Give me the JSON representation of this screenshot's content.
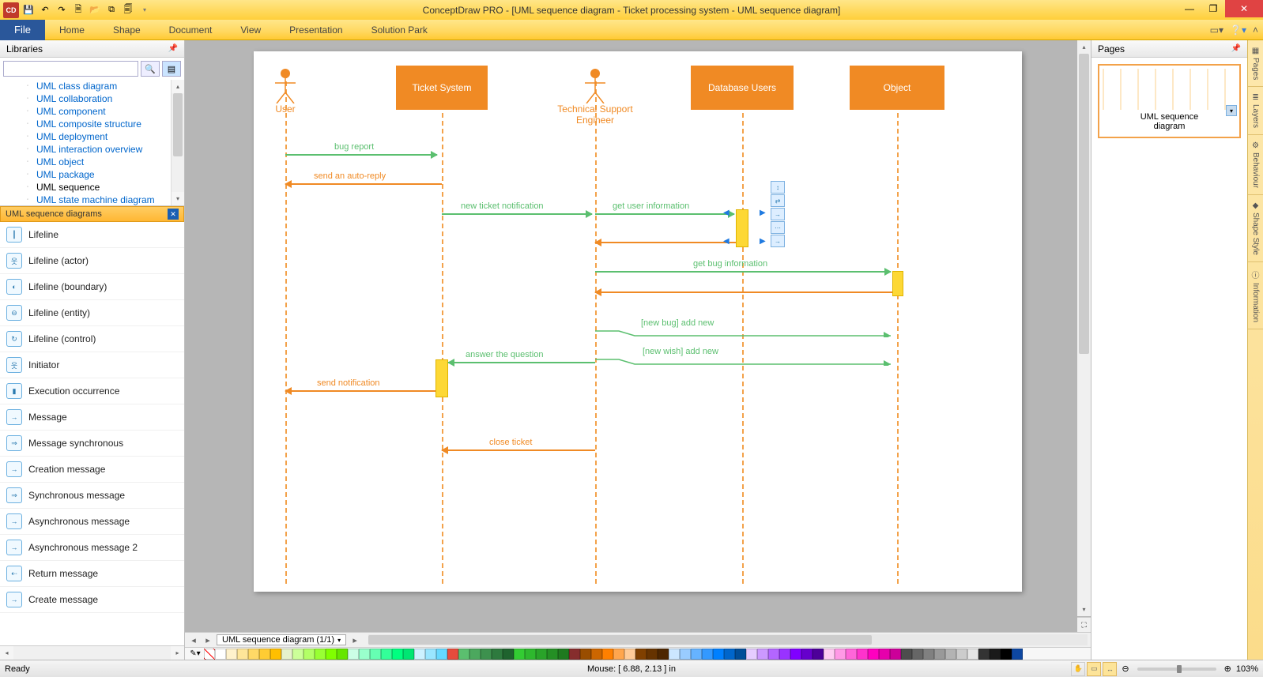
{
  "titlebar": {
    "title": "ConceptDraw PRO - [UML sequence diagram - Ticket processing system - UML sequence diagram]"
  },
  "ribbon": {
    "file": "File",
    "tabs": [
      "Home",
      "Shape",
      "Document",
      "View",
      "Presentation",
      "Solution Park"
    ]
  },
  "libraries": {
    "title": "Libraries",
    "search_placeholder": "",
    "tree": [
      "UML class diagram",
      "UML collaboration",
      "UML component",
      "UML composite structure",
      "UML deployment",
      "UML interaction overview",
      "UML object",
      "UML package",
      "UML sequence",
      "UML state machine diagram"
    ],
    "tree_selected_index": 8,
    "stencil_title": "UML sequence diagrams",
    "shapes": [
      "Lifeline",
      "Lifeline (actor)",
      "Lifeline (boundary)",
      "Lifeline (entity)",
      "Lifeline (control)",
      "Initiator",
      "Execution occurrence",
      "Message",
      "Message synchronous",
      "Creation message",
      "Synchronous message",
      "Asynchronous message",
      "Asynchronous message 2",
      "Return message",
      "Create message"
    ]
  },
  "diagram": {
    "actors": {
      "user": "User",
      "engineer_l1": "Technical Support",
      "engineer_l2": "Engineer"
    },
    "participants": {
      "ticket": "Ticket System",
      "db": "Database Users",
      "obj": "Object"
    },
    "messages": {
      "bug_report": "bug report",
      "auto_reply": "send an auto-reply",
      "new_ticket": "new ticket notification",
      "get_user": "get user information",
      "get_bug": "get bug information",
      "add_bug": "[new bug] add new",
      "add_wish": "[new wish] add new",
      "answer": "answer the question",
      "send_notif": "send notification",
      "close": "close ticket"
    }
  },
  "page_tabs": {
    "name": "UML sequence diagram (1/1)"
  },
  "pages_panel": {
    "title": "Pages",
    "thumb_caption_l1": "UML sequence",
    "thumb_caption_l2": "diagram"
  },
  "side_tabs": [
    "Pages",
    "Layers",
    "Behaviour",
    "Shape Style",
    "Information"
  ],
  "statusbar": {
    "ready": "Ready",
    "mouse": "Mouse: [ 6.88, 2.13 ] in",
    "zoom": "103%"
  },
  "colors": [
    "#ffffff",
    "#fff2cc",
    "#ffe699",
    "#ffd966",
    "#ffcc33",
    "#ffbf00",
    "#e6f2cc",
    "#ccff99",
    "#b3ff66",
    "#99ff33",
    "#80ff00",
    "#66e600",
    "#ccffe6",
    "#99ffcc",
    "#66ffb3",
    "#33ff99",
    "#00ff80",
    "#00e673",
    "#ccf2ff",
    "#99e6ff",
    "#66d9ff",
    "#e74c3c",
    "#5bbf6f",
    "#4ca85e",
    "#3d914e",
    "#2e7a3e",
    "#1f632e",
    "#33cc33",
    "#2eb82e",
    "#29a329",
    "#248f24",
    "#1f7a1f",
    "#862d2d",
    "#994d00",
    "#cc6600",
    "#ff8000",
    "#ffa64d",
    "#ffcc99",
    "#804000",
    "#663300",
    "#4d2600",
    "#cce6ff",
    "#99ccff",
    "#66b3ff",
    "#3399ff",
    "#0080ff",
    "#0066cc",
    "#004d99",
    "#e6ccff",
    "#cc99ff",
    "#b366ff",
    "#9933ff",
    "#8000ff",
    "#6600cc",
    "#4d0099",
    "#ffccf2",
    "#ff99e6",
    "#ff66d9",
    "#ff33cc",
    "#ff00bf",
    "#e600ac",
    "#cc0099",
    "#4d4d4d",
    "#666666",
    "#808080",
    "#999999",
    "#b3b3b3",
    "#cccccc",
    "#e6e6e6",
    "#333333",
    "#1a1a1a",
    "#000000",
    "#0d47a1"
  ]
}
